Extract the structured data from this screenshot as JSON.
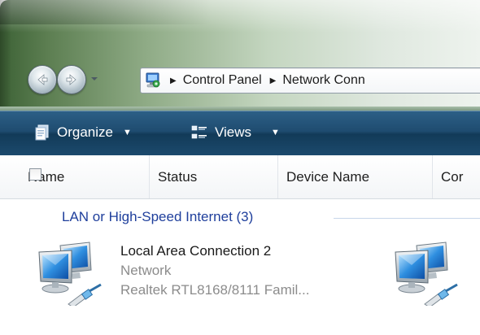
{
  "address": {
    "breadcrumbs": [
      "Control Panel",
      "Network Conn"
    ]
  },
  "toolbar": {
    "organize_label": "Organize",
    "views_label": "Views"
  },
  "columns": [
    "Name",
    "Status",
    "Device Name",
    "Cor"
  ],
  "group": {
    "label": "LAN or High-Speed Internet (3)"
  },
  "items": [
    {
      "name": "Local Area Connection 2",
      "status": "Network",
      "device": "Realtek RTL8168/8111 Famil..."
    }
  ],
  "colors": {
    "toolbar": "#1f4c70",
    "group_text": "#1f3f9c",
    "subtext": "#8c8c8c"
  },
  "icons": [
    "back-arrow-icon",
    "forward-arrow-icon",
    "control-panel-icon",
    "organize-icon",
    "views-icon",
    "network-connection-icon"
  ]
}
